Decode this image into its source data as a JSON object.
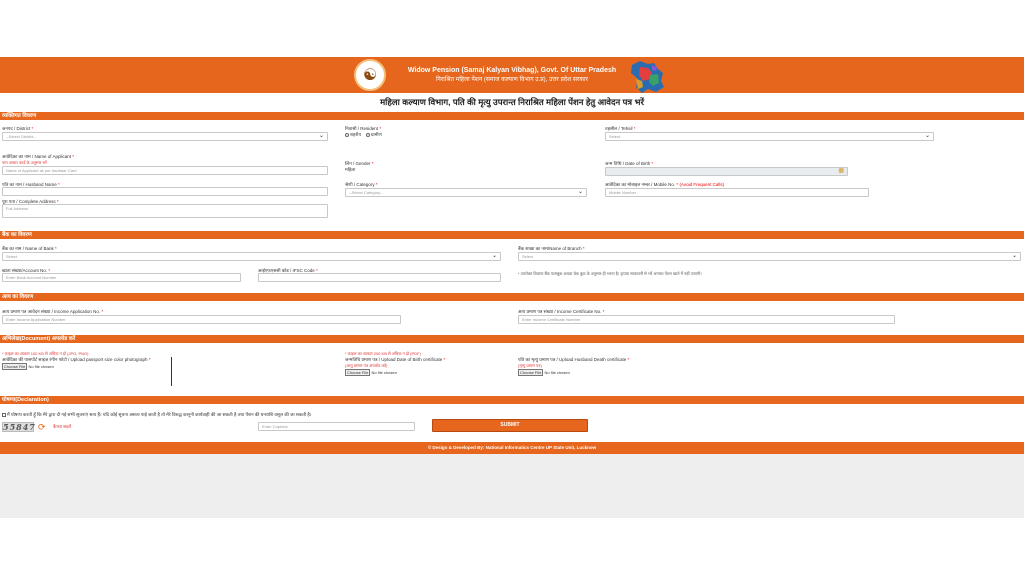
{
  "header": {
    "title": "Widow Pension (Samaj Kalyan Vibhag), Govt. Of Uttar Pradesh",
    "subtitle": "निराश्रित महिला पेंशन (समाज कल्याण विभाग उ.प्र), उत्तर प्रदेश सरकार",
    "logo_icon": "up-govt-emblem-icon",
    "map_icon": "up-map-icon"
  },
  "page_heading": "महिला कल्याण विभाग, पति की मृत्यु उपरान्त निराश्रित महिला पेंशन हेतु आवेदन पत्र भरें",
  "sections": {
    "personal": "व्यक्तिगत विवरण",
    "bank": "बैंक का विवरण",
    "income": "आय का विवरण",
    "documents": "अभिलेख(Document) अपलोड करें",
    "declaration": "घोषणा(Declaration)"
  },
  "personal": {
    "district_label": "जनपद / District",
    "district_value": "--Select District--",
    "resident_label": "निवासी / Resident",
    "resident_options": [
      "शहरीय",
      "ग्रामीण"
    ],
    "tehsil_label": "तहसील / Tehsil",
    "tehsil_value": "Select",
    "applicant_label": "आवेदिका का नाम / Name of Applicant",
    "applicant_note": "नाम आधार कार्ड के अनुसार भरें",
    "applicant_placeholder": "Name of Applicant as per Aadhaar Card",
    "gender_label": "लिंग / Gender",
    "gender_value": "महिला",
    "dob_label": "जन्म तिथि / Date of Birth",
    "husband_label": "पति का नाम / Husband Name",
    "category_label": "श्रेणी / Category",
    "category_value": "--Select Category--",
    "mobile_label": "आवेदिका का मोबाइल नम्बर / Mobile No.",
    "mobile_note": "(Avoid Frequent Calls)",
    "mobile_placeholder": "Mobile Number",
    "address_label": "पूरा पता / Complete Address",
    "address_placeholder": "Full Address"
  },
  "bank": {
    "bank_label": "बैंक का नाम / Name of Bank",
    "bank_value": "Select",
    "branch_label": "बैंक शाखा का नाम/Name of Branch",
    "branch_value": "Select",
    "account_label": "खाता संख्या/Account No.",
    "account_placeholder": "Enter Bank Account Number",
    "ifsc_label": "आईएफ़एससी कोड / IFSC Code",
    "note": "* उपरोक्त विवरण बैंक पासबुक अथवा चेक बुक के अनुसार ही भरना है। कृपया सावधानी से भरें अन्यथा पेंशन खाते में नहीं जाएगी।"
  },
  "income": {
    "app_label": "आय प्रमाण पत्र आवेदन संख्या / Income Application No.",
    "app_placeholder": "Enter Income Application Number",
    "cert_label": "आय प्रमाण पत्र संख्या / Income Certificate No.",
    "cert_placeholder": "Enter Income Certificate Number"
  },
  "documents": {
    "note_left": "* फ़ाइल का आकार 100 KB से अधिक न हो (JPG, PNG)",
    "note_mid": "* फ़ाइल का आकार 200 KB से अधिक न हो (PDF)",
    "photo_label": "आवेदिका की पासपोर्ट साइज़ रंगीन फोटो / Upload passport size color photograph",
    "dob_cert_label": "जन्मतिथि प्रमाण पत्र / Upload Date of Birth certificate",
    "dob_cert_note": "(आयु प्रमाण पत्र अपलोड करें)",
    "death_cert_label": "पति का मृत्यु प्रमाण पत्र / Upload Husband Death certificate",
    "death_cert_note": "(मृत्यु प्रमाण पत्र)",
    "choose_label": "Choose File",
    "no_file": "No file chosen"
  },
  "declaration": {
    "text": "मैं घोषणा करती हूँ कि मेरे द्वारा दी गई सभी सूचनाएं सत्य हैं। यदि कोई सूचना असत्य पाई जाती है तो मेरे विरुद्ध कानूनी कार्यवाही की जा सकती है तथा पेंशन की धनराशि वसूल की जा सकती है।",
    "captcha_text": "55847",
    "refresh_link": "कैप्चा बदलें",
    "captcha_placeholder": "Enter Captcha",
    "submit_label": "SUBMIT"
  },
  "footer": "© Design & Developed By: National Informatics Centre UP State Unit, Lucknow"
}
